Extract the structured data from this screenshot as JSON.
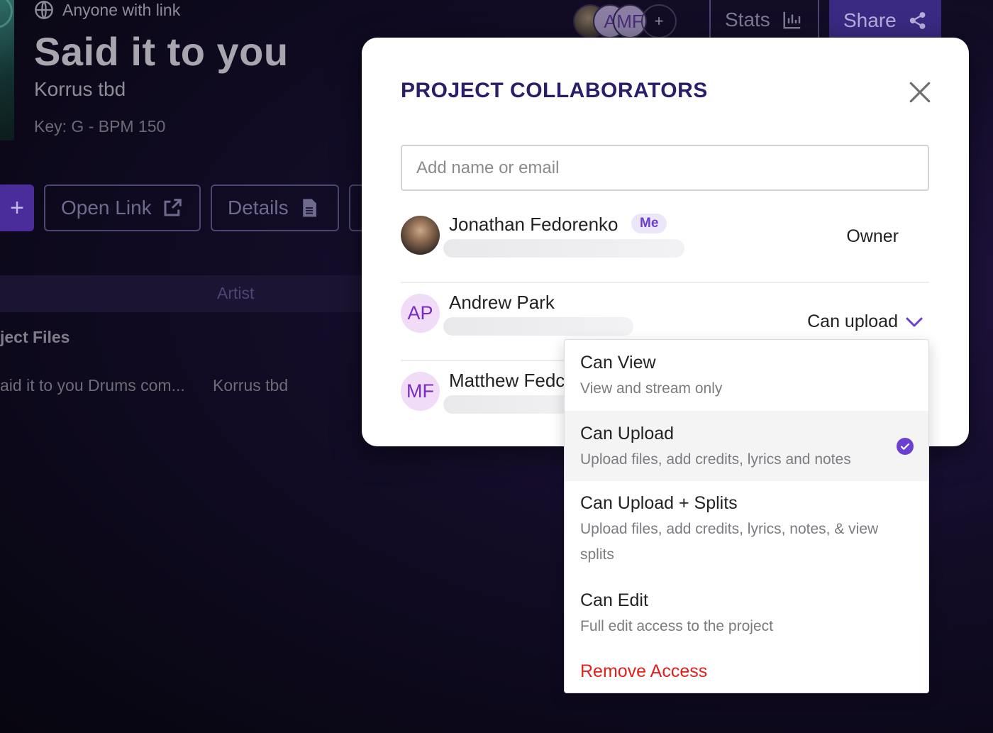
{
  "header": {
    "share_scope": "Anyone with link",
    "song_title": "Said it to you",
    "artist": "Korrus tbd",
    "meta": "Key: G - BPM 150",
    "avatars": [
      "A",
      "MF",
      "+"
    ],
    "stats_label": "Stats",
    "share_label": "Share"
  },
  "actions": {
    "add_label": "+",
    "open_link_label": "Open Link",
    "details_label": "Details"
  },
  "files": {
    "column_artist": "Artist",
    "section_title": "ject Files",
    "rows": [
      {
        "name": "aid it to you Drums com...",
        "artist": "Korrus tbd"
      }
    ]
  },
  "modal": {
    "title": "PROJECT COLLABORATORS",
    "input_placeholder": "Add name or email",
    "collaborators": [
      {
        "name": "Jonathan Fedorenko",
        "badge": "Me",
        "role": "Owner",
        "initials": ""
      },
      {
        "name": "Andrew Park",
        "role": "Can upload",
        "initials": "AP"
      },
      {
        "name": "Matthew Fedc",
        "initials": "MF"
      }
    ]
  },
  "role_dropdown": {
    "options": [
      {
        "title": "Can View",
        "desc": "View and stream only",
        "selected": false
      },
      {
        "title": "Can Upload",
        "desc": "Upload files, add credits, lyrics and notes",
        "selected": true
      },
      {
        "title": "Can Upload + Splits",
        "desc": "Upload files, add credits, lyrics, notes, & view splits",
        "selected": false
      },
      {
        "title": "Can Edit",
        "desc": "Full edit access to the project",
        "selected": false
      }
    ],
    "remove_label": "Remove Access"
  },
  "colors": {
    "accent": "#6b3fd1",
    "title": "#2a1e6b",
    "danger": "#e0201c",
    "avatar_bg": "#f1dcf7"
  }
}
